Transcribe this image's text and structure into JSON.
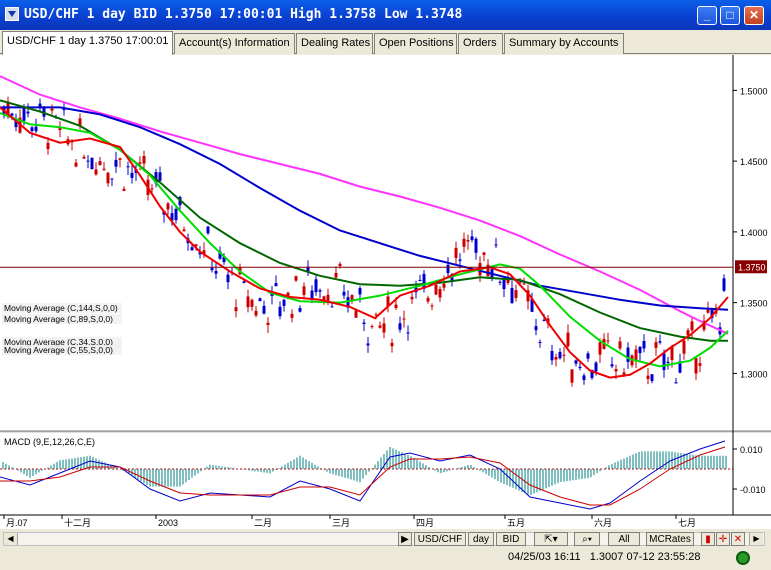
{
  "window": {
    "title": "USD/CHF 1 day BID 1.3750 17:00:01 High 1.3758 Low 1.3748",
    "controls": [
      "_",
      "□",
      "✕"
    ]
  },
  "tabs": [
    {
      "label": "USD/CHF 1 day 1.3750 17:00:01",
      "active": true
    },
    {
      "label": "Account(s) Information",
      "active": false
    },
    {
      "label": "Dealing Rates",
      "active": false
    },
    {
      "label": "Open Positions",
      "active": false
    },
    {
      "label": "Orders",
      "active": false
    },
    {
      "label": "Summary by Accounts",
      "active": false
    }
  ],
  "chart_data": {
    "type": "line",
    "price": {
      "yticks": [
        "1.5000",
        "1.4500",
        "1.4000",
        "1.3500",
        "1.3000"
      ],
      "ylim": [
        1.26,
        1.525
      ],
      "last_price": "1.3750",
      "ma_labels": [
        "Moving Average (C,144,S,0,0)",
        "Moving Average (C,89,S,0,0)",
        "Moving Average (C,34,S,0,0)",
        "Moving Average (C,55,S,0,0)"
      ],
      "series": [
        {
          "color": "#ff33ff",
          "x": [
            0,
            40,
            80,
            120,
            160,
            200,
            240,
            280,
            320,
            360,
            400,
            440,
            480,
            520,
            560,
            600,
            640,
            680,
            700,
            728
          ],
          "values": [
            1.51,
            1.497,
            1.488,
            1.48,
            1.471,
            1.463,
            1.455,
            1.448,
            1.441,
            1.432,
            1.425,
            1.417,
            1.408,
            1.397,
            1.384,
            1.372,
            1.359,
            1.344,
            1.337,
            1.328
          ]
        },
        {
          "color": "#0000cc",
          "x": [
            0,
            60,
            100,
            140,
            180,
            220,
            260,
            300,
            340,
            380,
            420,
            460,
            500,
            540,
            580,
            620,
            660,
            700,
            728
          ],
          "values": [
            1.488,
            1.488,
            1.483,
            1.474,
            1.462,
            1.448,
            1.431,
            1.415,
            1.401,
            1.392,
            1.383,
            1.376,
            1.369,
            1.362,
            1.357,
            1.352,
            1.348,
            1.346,
            1.345
          ]
        },
        {
          "color": "#006600",
          "x": [
            0,
            40,
            80,
            120,
            160,
            200,
            240,
            280,
            320,
            360,
            400,
            440,
            480,
            520,
            560,
            600,
            640,
            680,
            710,
            728
          ],
          "values": [
            1.493,
            1.485,
            1.475,
            1.458,
            1.435,
            1.41,
            1.392,
            1.378,
            1.369,
            1.363,
            1.362,
            1.364,
            1.368,
            1.366,
            1.356,
            1.343,
            1.332,
            1.326,
            1.323,
            1.323
          ]
        },
        {
          "color": "#00dd00",
          "x": [
            0,
            30,
            60,
            90,
            120,
            150,
            180,
            210,
            240,
            270,
            300,
            340,
            380,
            420,
            460,
            500,
            520,
            540,
            570,
            600,
            630,
            660,
            690,
            710,
            728
          ],
          "values": [
            1.484,
            1.476,
            1.474,
            1.47,
            1.458,
            1.44,
            1.415,
            1.392,
            1.372,
            1.357,
            1.351,
            1.35,
            1.355,
            1.362,
            1.37,
            1.377,
            1.374,
            1.362,
            1.34,
            1.323,
            1.31,
            1.305,
            1.309,
            1.318,
            1.33
          ]
        },
        {
          "color": "#ee0000",
          "x": [
            0,
            30,
            60,
            90,
            120,
            140,
            160,
            180,
            200,
            230,
            260,
            290,
            320,
            350,
            375,
            400,
            430,
            460,
            490,
            510,
            530,
            550,
            570,
            590,
            610,
            630,
            650,
            670,
            690,
            710,
            728
          ],
          "values": [
            1.488,
            1.47,
            1.463,
            1.466,
            1.46,
            1.44,
            1.418,
            1.4,
            1.386,
            1.372,
            1.36,
            1.354,
            1.352,
            1.347,
            1.339,
            1.355,
            1.362,
            1.372,
            1.375,
            1.37,
            1.355,
            1.334,
            1.315,
            1.302,
            1.297,
            1.299,
            1.307,
            1.318,
            1.327,
            1.339,
            1.354
          ]
        }
      ]
    },
    "macd": {
      "label": "MACD (9,E,12,26,C,E)",
      "yticks": [
        "0.010",
        "-0.010"
      ],
      "ylim": [
        -0.022,
        0.018
      ],
      "series": [
        {
          "color": "#0000cc",
          "x": [
            0,
            30,
            60,
            90,
            120,
            150,
            180,
            210,
            240,
            270,
            300,
            330,
            360,
            390,
            410,
            440,
            470,
            500,
            530,
            560,
            590,
            610,
            640,
            670,
            700,
            725
          ],
          "values": [
            -0.004,
            -0.008,
            -0.002,
            0.004,
            0.001,
            -0.01,
            -0.016,
            -0.012,
            -0.013,
            -0.014,
            -0.006,
            -0.01,
            -0.016,
            0.006,
            0.008,
            0.004,
            0.007,
            0.0,
            -0.014,
            -0.017,
            -0.02,
            -0.017,
            -0.006,
            0.004,
            0.01,
            0.014
          ]
        },
        {
          "color": "#cc0000",
          "x": [
            0,
            30,
            60,
            90,
            120,
            150,
            180,
            210,
            240,
            270,
            300,
            330,
            360,
            390,
            410,
            440,
            470,
            500,
            530,
            560,
            590,
            610,
            640,
            670,
            700,
            725
          ],
          "values": [
            -0.006,
            -0.006,
            -0.004,
            0.001,
            0.001,
            -0.006,
            -0.012,
            -0.013,
            -0.013,
            -0.013,
            -0.009,
            -0.009,
            -0.013,
            0.001,
            0.005,
            0.005,
            0.006,
            0.003,
            -0.008,
            -0.014,
            -0.018,
            -0.018,
            -0.01,
            0.0,
            0.007,
            0.011
          ]
        }
      ]
    },
    "xticks": [
      "月.07",
      "十二月",
      "2003",
      "二月",
      "三月",
      "四月",
      "五月",
      "六月",
      "七月"
    ]
  },
  "toolbar": {
    "symbol": "USD/CHF",
    "period": "day",
    "side": "BID",
    "all": "All",
    "rates": "MCRates",
    "q": "Q"
  },
  "status": {
    "text": "04/25/03 16:11   1.3007 07-12 23:55:28"
  }
}
